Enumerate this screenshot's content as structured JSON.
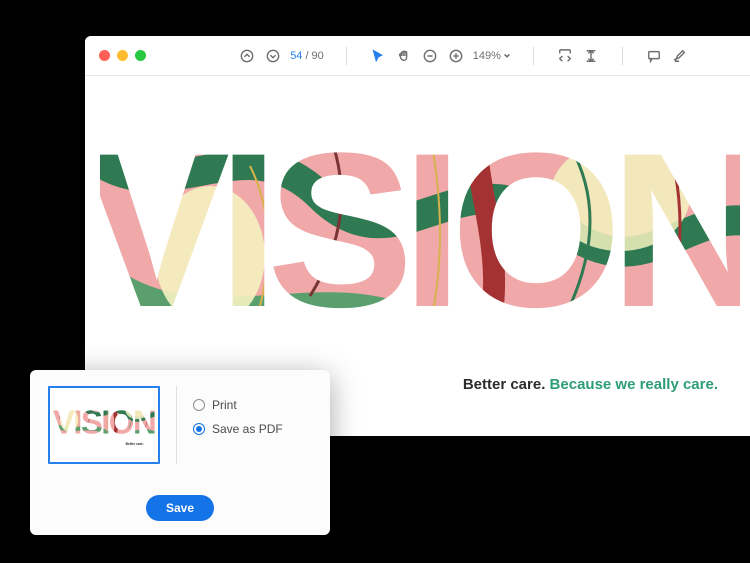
{
  "toolbar": {
    "current_page": "54",
    "page_sep": "/",
    "total_pages": "90",
    "zoom": "149%"
  },
  "document": {
    "headline": "VISION",
    "tagline_lead": "Better care. ",
    "tagline_accent": "Because we really care."
  },
  "dialog": {
    "options": {
      "print": "Print",
      "save_pdf": "Save as PDF"
    },
    "save_label": "Save"
  },
  "colors": {
    "accent_blue": "#1473e6",
    "accent_green": "#2d9d78"
  }
}
